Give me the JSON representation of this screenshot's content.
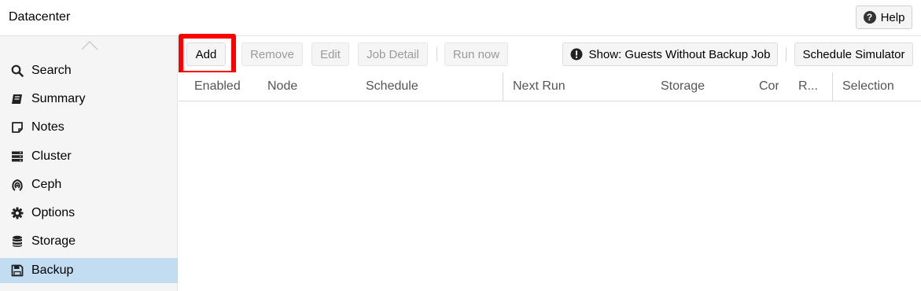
{
  "header": {
    "title": "Datacenter",
    "help_label": "Help"
  },
  "sidebar": {
    "items": [
      {
        "label": "Search",
        "icon": "search-icon"
      },
      {
        "label": "Summary",
        "icon": "book-icon"
      },
      {
        "label": "Notes",
        "icon": "note-icon"
      },
      {
        "label": "Cluster",
        "icon": "server-icon"
      },
      {
        "label": "Ceph",
        "icon": "ceph-icon"
      },
      {
        "label": "Options",
        "icon": "gear-icon"
      },
      {
        "label": "Storage",
        "icon": "database-icon"
      },
      {
        "label": "Backup",
        "icon": "floppy-icon",
        "active": true
      }
    ]
  },
  "toolbar": {
    "add": "Add",
    "remove": "Remove",
    "edit": "Edit",
    "job_detail": "Job Detail",
    "run_now": "Run now",
    "show_guests": "Show: Guests Without Backup Job",
    "schedule_simulator": "Schedule Simulator"
  },
  "grid": {
    "columns": [
      "Enabled",
      "Node",
      "Schedule",
      "Next Run",
      "Storage",
      "Cor",
      "R...",
      "Selection"
    ],
    "rows": []
  },
  "colors": {
    "active_nav": "#c2ddf2",
    "highlight": "#ff0000"
  }
}
